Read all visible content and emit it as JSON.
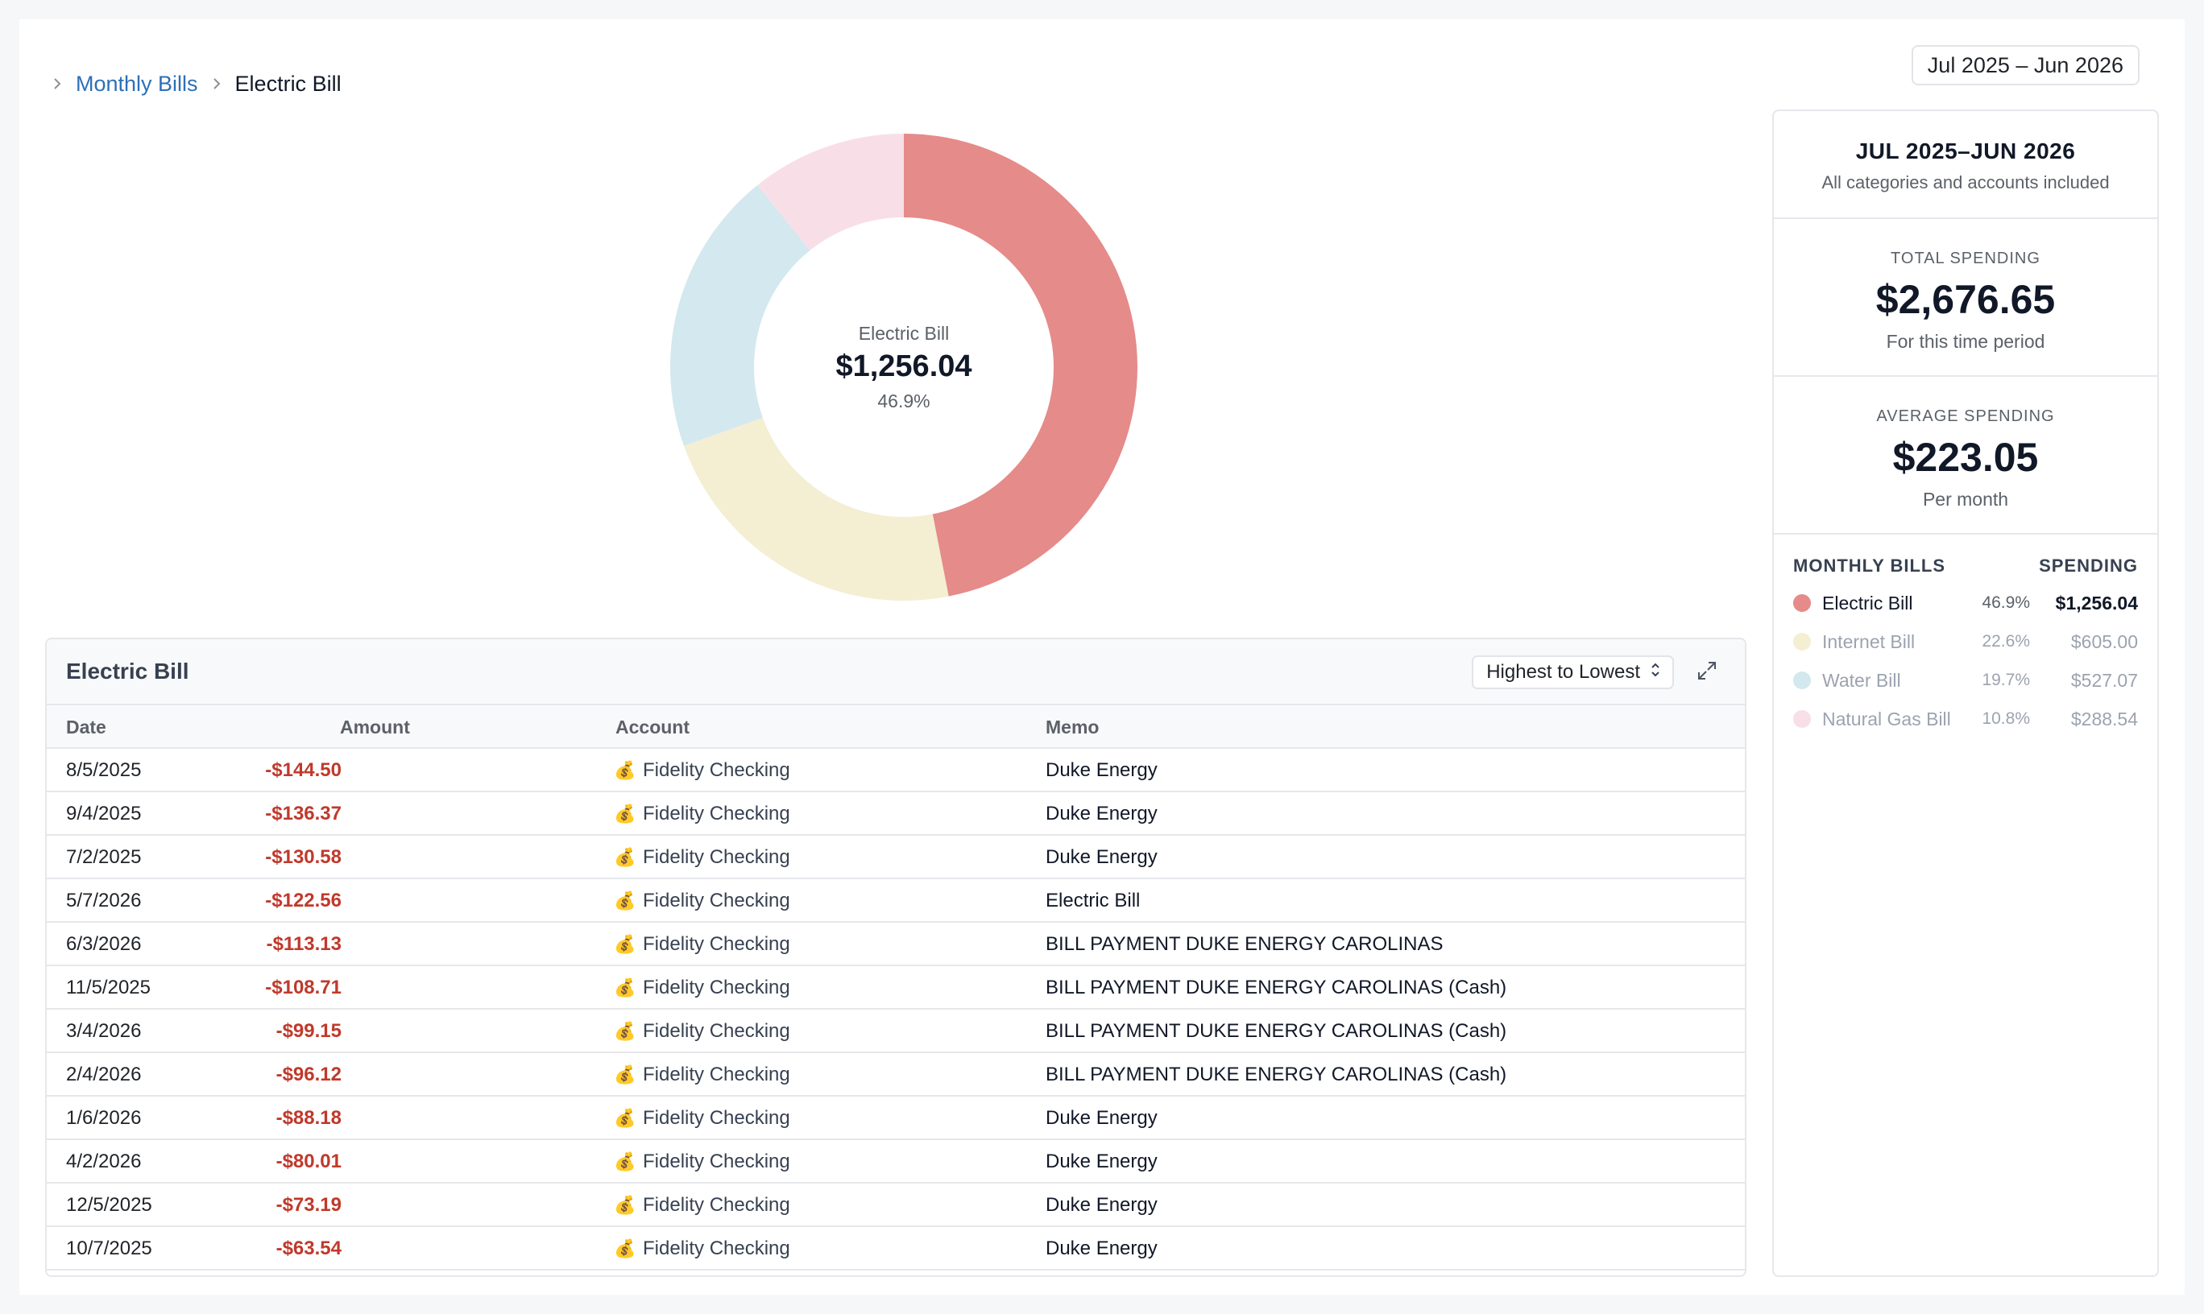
{
  "breadcrumb": {
    "parent": "Monthly Bills",
    "current": "Electric Bill"
  },
  "date_range": "Jul 2025 – Jun 2026",
  "donut": {
    "center_label": "Electric Bill",
    "center_value": "$1,256.04",
    "center_pct": "46.9%",
    "segments": [
      {
        "name": "Electric Bill",
        "value": 1256.04,
        "color": "#e58b8a"
      },
      {
        "name": "Internet Bill",
        "value": 605.0,
        "color": "#f4eed3"
      },
      {
        "name": "Water Bill",
        "value": 527.07,
        "color": "#d3e8ef"
      },
      {
        "name": "Natural Gas Bill",
        "value": 288.54,
        "color": "#f8dfe7"
      }
    ]
  },
  "table": {
    "title": "Electric Bill",
    "sort_label": "Highest to Lowest",
    "columns": {
      "date": "Date",
      "amount": "Amount",
      "account": "Account",
      "memo": "Memo"
    },
    "account_icon": "money-bag-icon",
    "rows": [
      {
        "date": "8/5/2025",
        "amount": "-$144.50",
        "account": "Fidelity Checking",
        "memo": "Duke Energy"
      },
      {
        "date": "9/4/2025",
        "amount": "-$136.37",
        "account": "Fidelity Checking",
        "memo": "Duke Energy"
      },
      {
        "date": "7/2/2025",
        "amount": "-$130.58",
        "account": "Fidelity Checking",
        "memo": "Duke Energy"
      },
      {
        "date": "5/7/2026",
        "amount": "-$122.56",
        "account": "Fidelity Checking",
        "memo": "Electric Bill"
      },
      {
        "date": "6/3/2026",
        "amount": "-$113.13",
        "account": "Fidelity Checking",
        "memo": "BILL PAYMENT DUKE ENERGY CAROLINAS"
      },
      {
        "date": "11/5/2025",
        "amount": "-$108.71",
        "account": "Fidelity Checking",
        "memo": "BILL PAYMENT DUKE ENERGY CAROLINAS (Cash)"
      },
      {
        "date": "3/4/2026",
        "amount": "-$99.15",
        "account": "Fidelity Checking",
        "memo": "BILL PAYMENT DUKE ENERGY CAROLINAS (Cash)"
      },
      {
        "date": "2/4/2026",
        "amount": "-$96.12",
        "account": "Fidelity Checking",
        "memo": "BILL PAYMENT DUKE ENERGY CAROLINAS (Cash)"
      },
      {
        "date": "1/6/2026",
        "amount": "-$88.18",
        "account": "Fidelity Checking",
        "memo": "Duke Energy"
      },
      {
        "date": "4/2/2026",
        "amount": "-$80.01",
        "account": "Fidelity Checking",
        "memo": "Duke Energy"
      },
      {
        "date": "12/5/2025",
        "amount": "-$73.19",
        "account": "Fidelity Checking",
        "memo": "Duke Energy"
      },
      {
        "date": "10/7/2025",
        "amount": "-$63.54",
        "account": "Fidelity Checking",
        "memo": "Duke Energy"
      }
    ]
  },
  "sidebar": {
    "period_title": "JUL 2025–JUN 2026",
    "period_sub": "All categories and accounts included",
    "total": {
      "label": "TOTAL SPENDING",
      "value": "$2,676.65",
      "sub": "For this time period"
    },
    "average": {
      "label": "AVERAGE SPENDING",
      "value": "$223.05",
      "sub": "Per month"
    },
    "legend_title": "MONTHLY BILLS",
    "legend_value_title": "SPENDING",
    "items": [
      {
        "name": "Electric Bill",
        "pct": "46.9%",
        "amount": "$1,256.04",
        "color": "#e58b8a"
      },
      {
        "name": "Internet Bill",
        "pct": "22.6%",
        "amount": "$605.00",
        "color": "#f4eed3"
      },
      {
        "name": "Water Bill",
        "pct": "19.7%",
        "amount": "$527.07",
        "color": "#d3e8ef"
      },
      {
        "name": "Natural Gas Bill",
        "pct": "10.8%",
        "amount": "$288.54",
        "color": "#f8dfe7"
      }
    ]
  }
}
